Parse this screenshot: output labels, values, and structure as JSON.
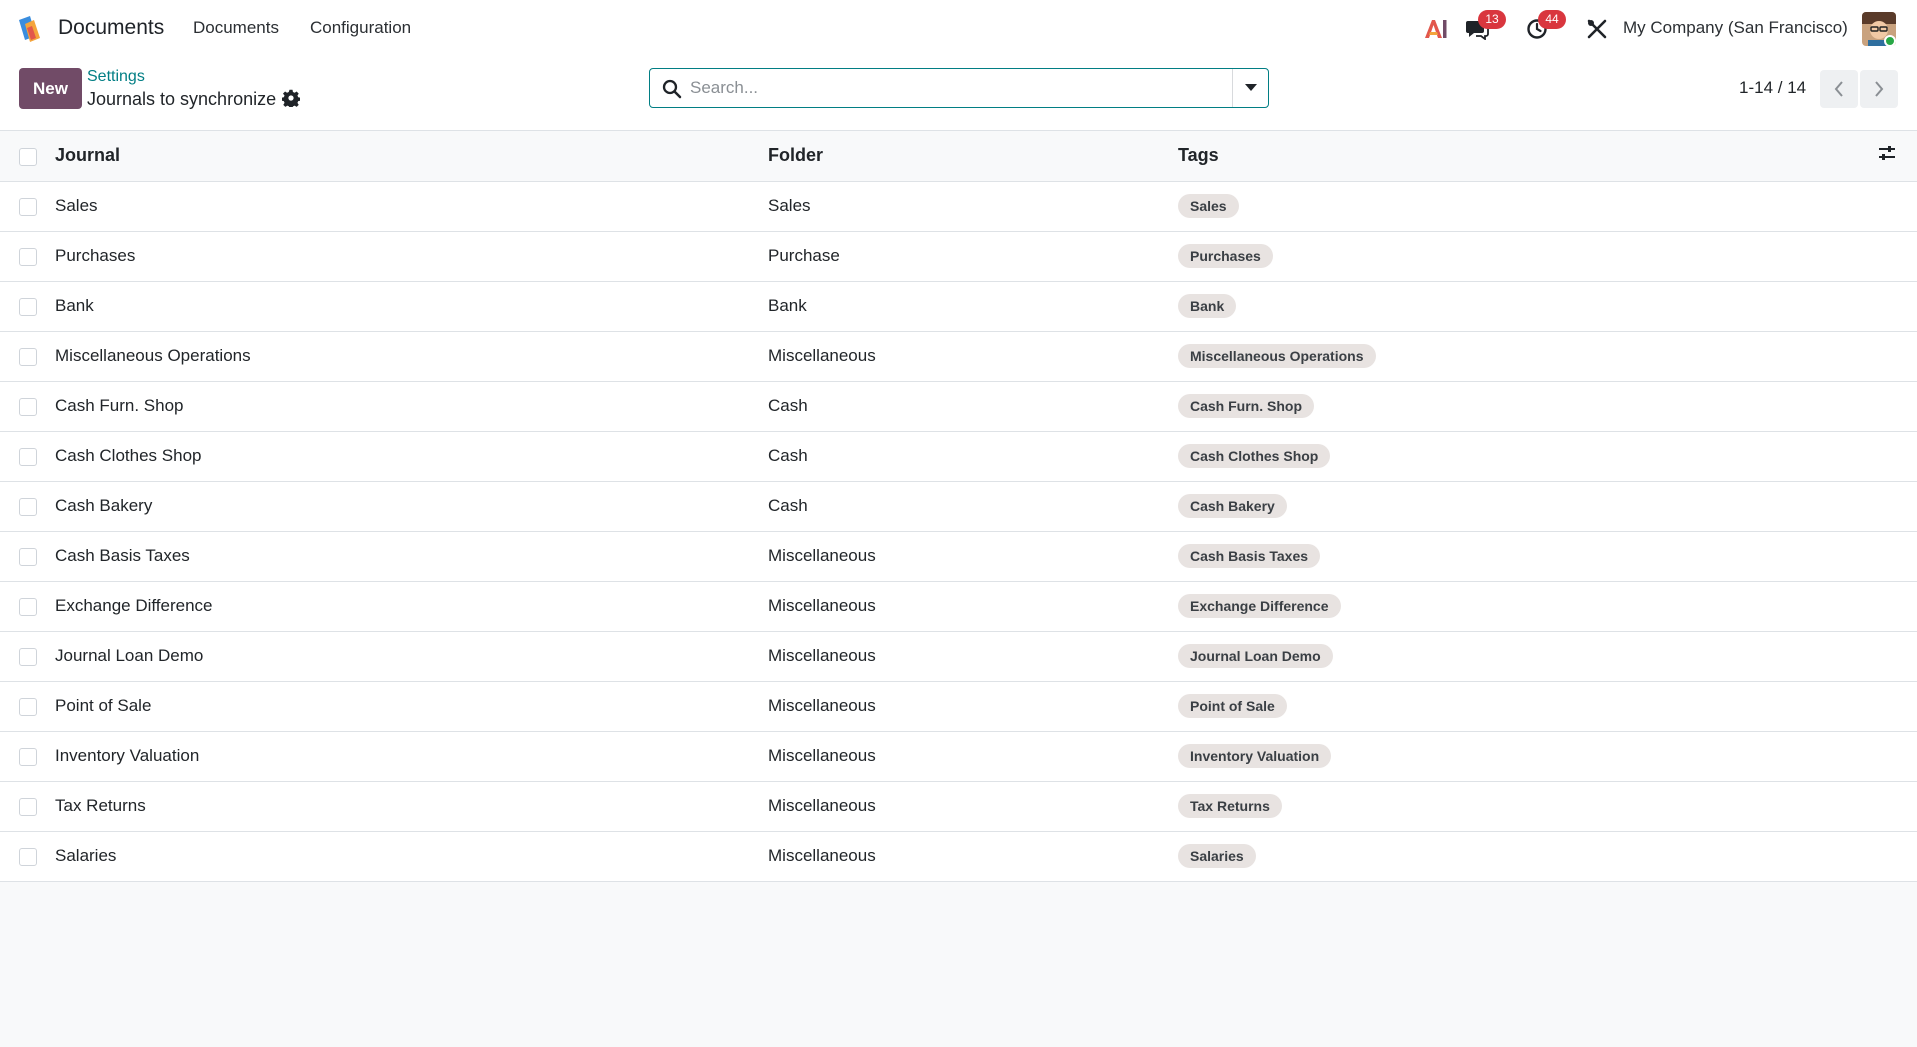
{
  "navbar": {
    "app_name": "Documents",
    "menus": [
      "Documents",
      "Configuration"
    ],
    "messages_count": "13",
    "activities_count": "44",
    "company": "My Company (San Francisco)",
    "ai_label": "AI"
  },
  "control_panel": {
    "new_label": "New",
    "breadcrumb_parent": "Settings",
    "breadcrumb_current": "Journals to synchronize",
    "search_placeholder": "Search...",
    "pager": "1-14 / 14"
  },
  "table": {
    "columns": [
      "Journal",
      "Folder",
      "Tags"
    ],
    "rows": [
      {
        "journal": "Sales",
        "folder": "Sales",
        "tag": "Sales"
      },
      {
        "journal": "Purchases",
        "folder": "Purchase",
        "tag": "Purchases"
      },
      {
        "journal": "Bank",
        "folder": "Bank",
        "tag": "Bank"
      },
      {
        "journal": "Miscellaneous Operations",
        "folder": "Miscellaneous",
        "tag": "Miscellaneous Operations"
      },
      {
        "journal": "Cash Furn. Shop",
        "folder": "Cash",
        "tag": "Cash Furn. Shop"
      },
      {
        "journal": "Cash Clothes Shop",
        "folder": "Cash",
        "tag": "Cash Clothes Shop"
      },
      {
        "journal": "Cash Bakery",
        "folder": "Cash",
        "tag": "Cash Bakery"
      },
      {
        "journal": "Cash Basis Taxes",
        "folder": "Miscellaneous",
        "tag": "Cash Basis Taxes"
      },
      {
        "journal": "Exchange Difference",
        "folder": "Miscellaneous",
        "tag": "Exchange Difference"
      },
      {
        "journal": "Journal Loan Demo",
        "folder": "Miscellaneous",
        "tag": "Journal Loan Demo"
      },
      {
        "journal": "Point of Sale",
        "folder": "Miscellaneous",
        "tag": "Point of Sale"
      },
      {
        "journal": "Inventory Valuation",
        "folder": "Miscellaneous",
        "tag": "Inventory Valuation"
      },
      {
        "journal": "Tax Returns",
        "folder": "Miscellaneous",
        "tag": "Tax Returns"
      },
      {
        "journal": "Salaries",
        "folder": "Miscellaneous",
        "tag": "Salaries"
      }
    ]
  },
  "colors": {
    "primary": "#714b67",
    "link": "#017e84",
    "badge": "#d9363e",
    "tag_bg": "#e8e3e1"
  }
}
